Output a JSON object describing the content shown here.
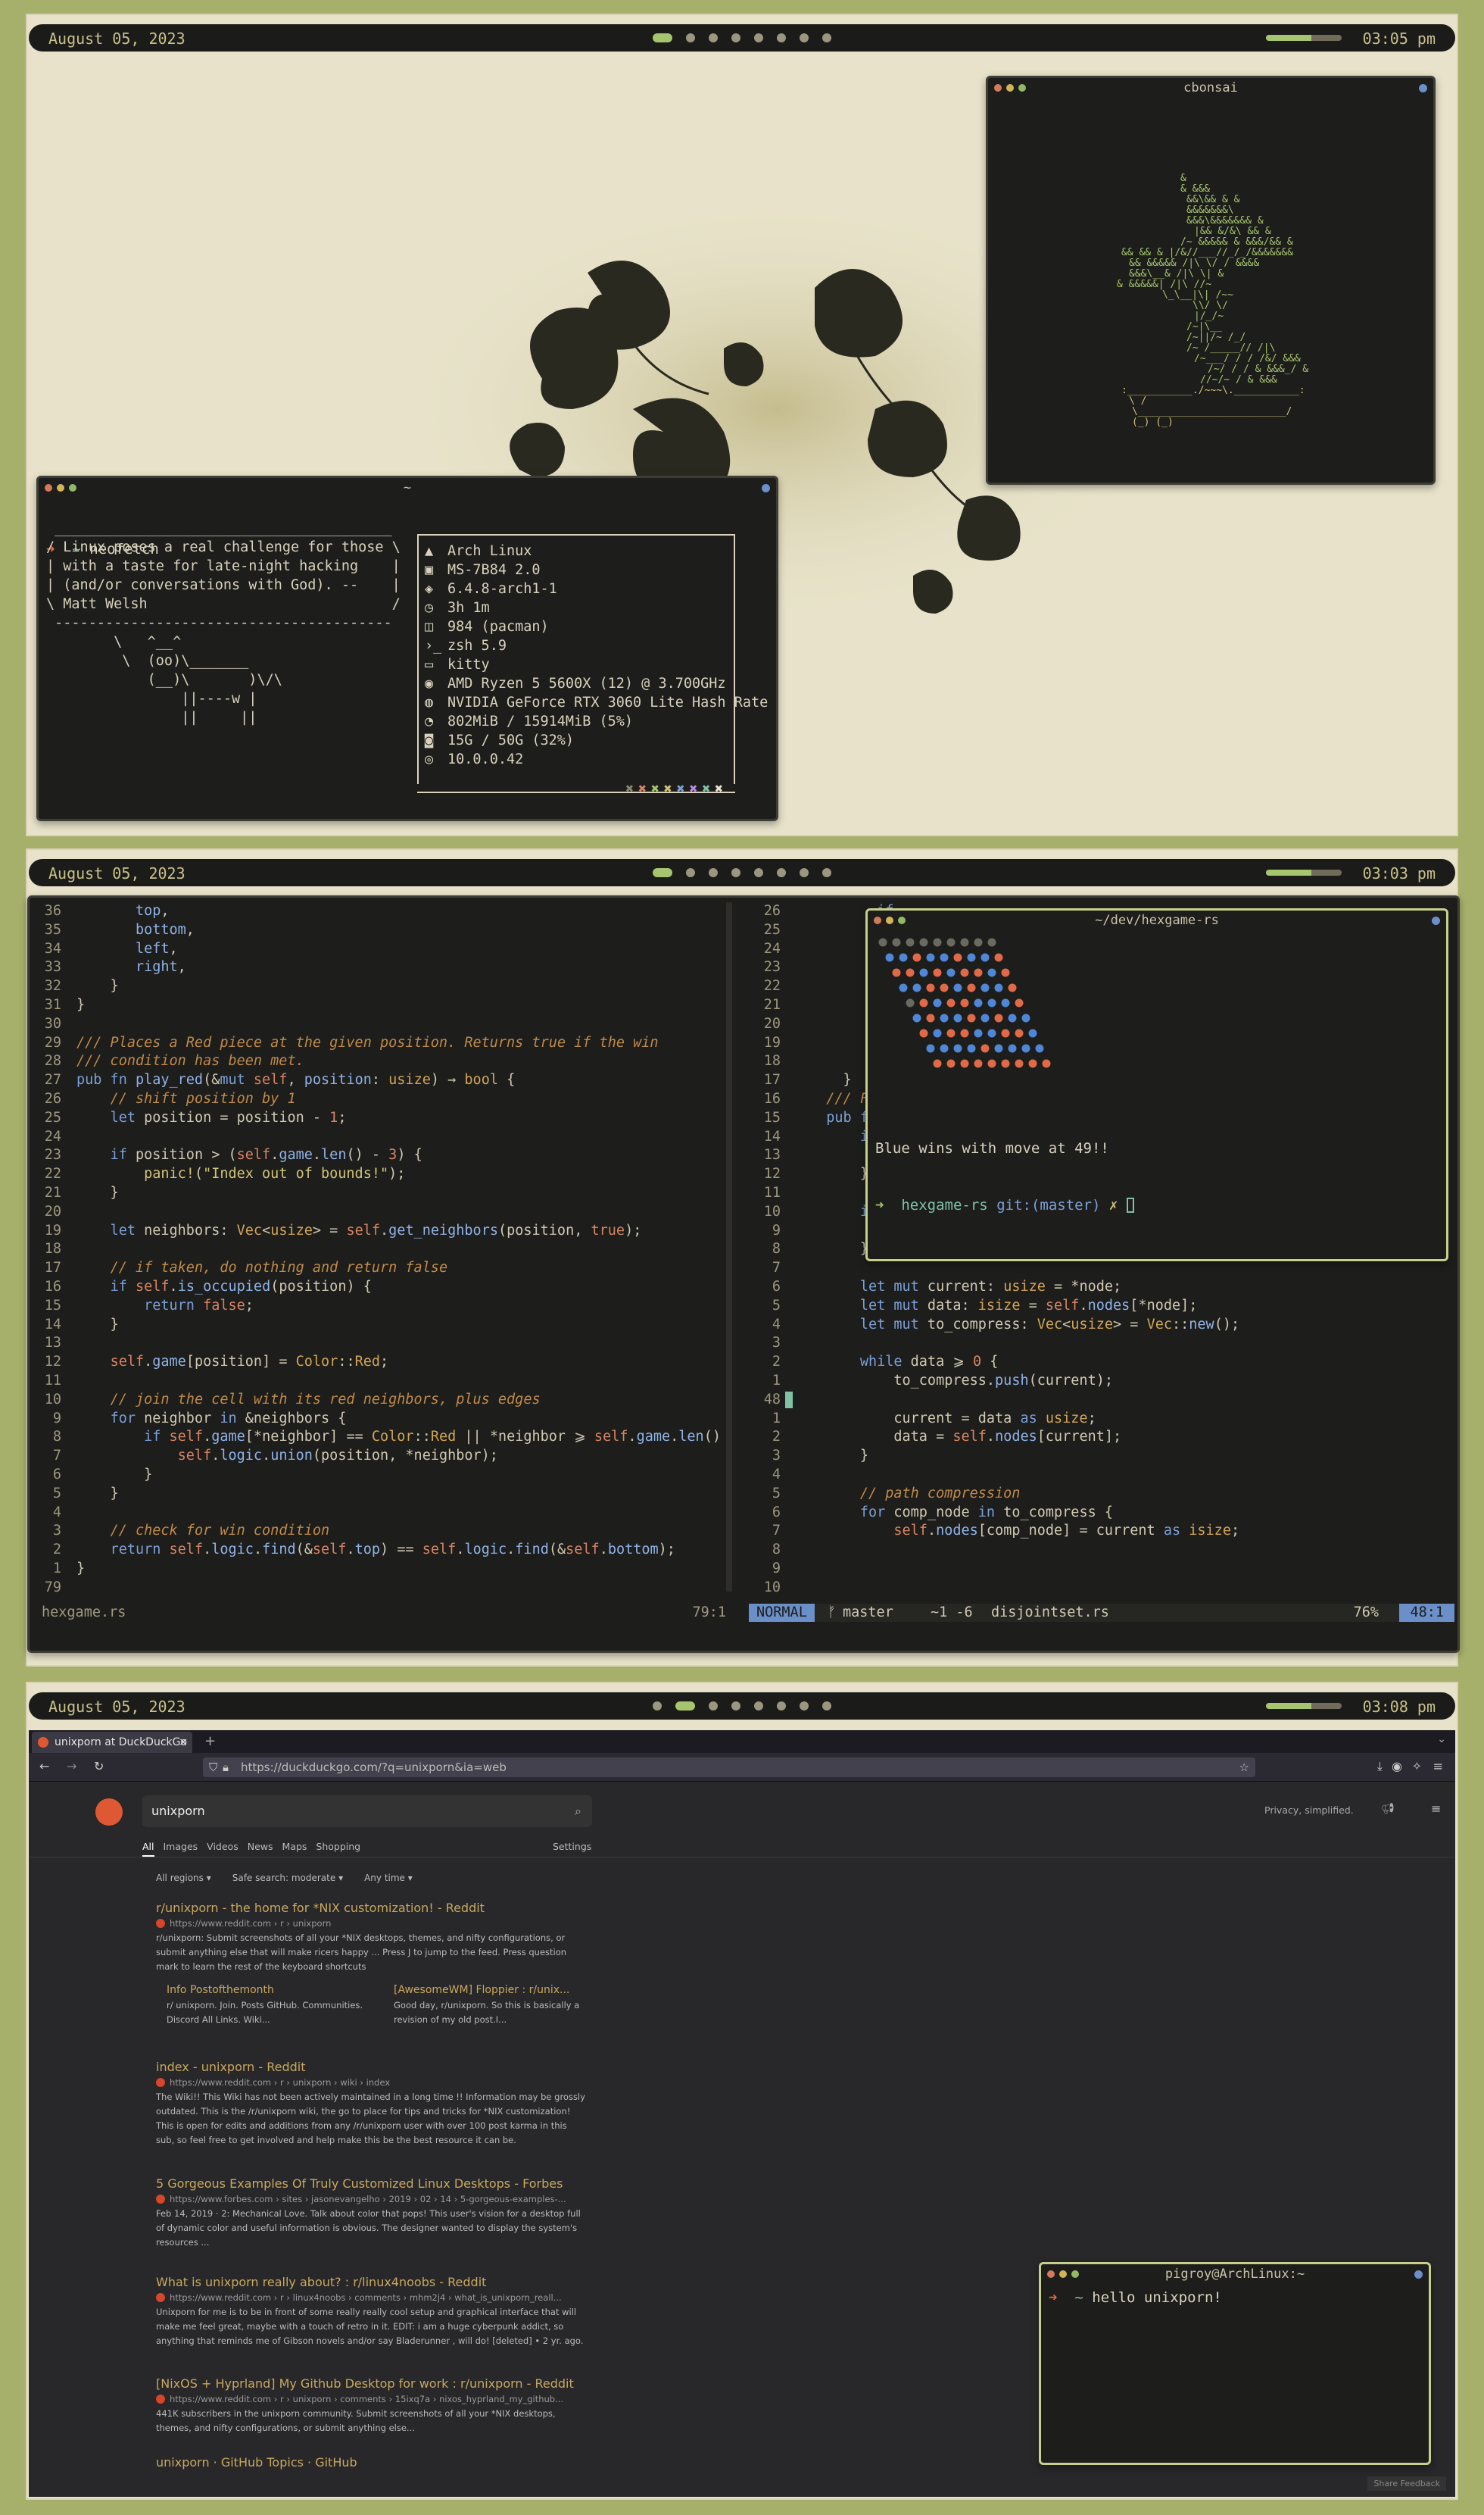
{
  "workspaces": [
    {
      "date": "August 05, 2023",
      "time": "03:05 pm",
      "active_index": 0,
      "dot_count": 8
    },
    {
      "date": "August 05, 2023",
      "time": "03:03 pm",
      "active_index": 0,
      "dot_count": 8
    },
    {
      "date": "August 05, 2023",
      "time": "03:08 pm",
      "active_index": 1,
      "dot_count": 8
    }
  ],
  "cbonsai": {
    "title": "cbonsai"
  },
  "neofetch": {
    "title": "~",
    "prompt_cmd": "neofetch",
    "quote_lines": [
      " ________________________________________",
      "/ Linux poses a real challenge for those \\",
      "| with a taste for late-night hacking    |",
      "| (and/or conversations with God). --    |",
      "\\ Matt Welsh                             /",
      " ----------------------------------------",
      "        \\   ^__^",
      "         \\  (oo)\\_______",
      "            (__)\\       )\\/\\",
      "                ||----w |",
      "                ||     ||"
    ],
    "info": [
      {
        "icon": "arch-icon",
        "text": "Arch Linux"
      },
      {
        "icon": "host-icon",
        "text": "MS-7B84 2.0"
      },
      {
        "icon": "kernel-icon",
        "text": "6.4.8-arch1-1"
      },
      {
        "icon": "clock-icon",
        "text": "3h 1m"
      },
      {
        "icon": "package-icon",
        "text": "984 (pacman)"
      },
      {
        "icon": "shell-icon",
        "text": "zsh 5.9"
      },
      {
        "icon": "terminal-icon",
        "text": "kitty"
      },
      {
        "icon": "cpu-icon",
        "text": "AMD Ryzen 5 5600X (12) @ 3.700GHz"
      },
      {
        "icon": "gpu-icon",
        "text": "NVIDIA GeForce RTX 3060 Lite Hash Rate"
      },
      {
        "icon": "memory-icon",
        "text": "802MiB / 15914MiB (5%)"
      },
      {
        "icon": "disk-icon",
        "text": "15G / 50G (32%)"
      },
      {
        "icon": "network-icon",
        "text": "10.0.0.42"
      }
    ],
    "palette": [
      "#8a8672",
      "#d88463",
      "#a7c46e",
      "#d2c27a",
      "#7b9fd8",
      "#b58ad8",
      "#7fc2a6",
      "#e8e2cc"
    ]
  },
  "editor": {
    "left_file": "hexgame.rs",
    "left_pos": "79:1",
    "mode": "NORMAL",
    "branch": "master",
    "diff": "~1 -6",
    "right_file": "disjointset.rs",
    "percent": "76%",
    "right_pos": "48:1",
    "left_gutter": [
      "36",
      "35",
      "34",
      "33",
      "32",
      "31",
      "30",
      "29",
      "28",
      "27",
      "26",
      "25",
      "24",
      "23",
      "22",
      "21",
      "20",
      "19",
      "18",
      "17",
      "16",
      "15",
      "14",
      "13",
      "12",
      "11",
      "10",
      "9",
      "8",
      "7",
      "6",
      "5",
      "4",
      "3",
      "2",
      "1",
      "79"
    ],
    "right_gutter": [
      "26",
      "25",
      "24",
      "23",
      "22",
      "21",
      "20",
      "19",
      "18",
      "17",
      "16",
      "15",
      "14",
      "13",
      "12",
      "11",
      "10",
      "9",
      "8",
      "7",
      "6",
      "5",
      "4",
      "3",
      "2",
      "1",
      "48",
      "1",
      "2",
      "3",
      "4",
      "5",
      "6",
      "7",
      "8",
      "9",
      "10"
    ]
  },
  "hexgame": {
    "title": "~/dev/hexgame-rs",
    "message": "Blue wins with move at 49!!",
    "dir": "hexgame-rs",
    "git": "git:(master)",
    "mark": "✗"
  },
  "browser": {
    "tab_title": "unixporn at DuckDuckGo",
    "url": "https://duckduckgo.com/?q=unixporn&ia=web",
    "query": "unixporn",
    "privacy": "Privacy, simplified.",
    "tabs": [
      "All",
      "Images",
      "Videos",
      "News",
      "Maps",
      "Shopping"
    ],
    "settings": "Settings",
    "filters": [
      "All regions",
      "Safe search: moderate",
      "Any time"
    ],
    "results": [
      {
        "title": "r/unixporn - the home for *NIX customization! - Reddit",
        "url": "https://www.reddit.com › r › unixporn",
        "snippet": "r/unixporn: Submit screenshots of all your *NIX desktops, themes, and nifty configurations, or submit anything else that will make ricers happy ... Press J to jump to the feed. Press question mark to learn the rest of the keyboard shortcuts"
      },
      {
        "title": "index - unixporn - Reddit",
        "url": "https://www.reddit.com › r › unixporn › wiki › index",
        "snippet": "The Wiki!! This Wiki has not been actively maintained in a long time !! Information may be grossly outdated. This is the /r/unixporn wiki, the go to place for tips and tricks for *NIX customization! This is open for edits and additions from any /r/unixporn user with over 100 post karma in this sub, so feel free to get involved and help make this be the best resource it can be."
      },
      {
        "title": "5 Gorgeous Examples Of Truly Customized Linux Desktops - Forbes",
        "url": "https://www.forbes.com › sites › jasonevangelho › 2019 › 02 › 14 › 5-gorgeous-examples-...",
        "snippet": "Feb 14, 2019 · 2: Mechanical Love. Talk about color that pops! This user's vision for a desktop full of dynamic color and useful information is obvious. The designer wanted to display the system's resources ..."
      },
      {
        "title": "What is unixporn really about? : r/linux4noobs - Reddit",
        "url": "https://www.reddit.com › r › linux4noobs › comments › mhm2j4 › what_is_unixporn_reall...",
        "snippet": "Unixporn for me is to be in front of some really really cool setup and graphical interface that will make me feel great, maybe with a touch of retro in it. EDIT: i am a huge cyberpunk addict, so anything that reminds me of Gibson novels and/or say Bladerunner , will do! [deleted] • 2 yr. ago."
      },
      {
        "title": "[NixOS + Hyprland] My Github Desktop for work : r/unixporn - Reddit",
        "url": "https://www.reddit.com › r › unixporn › comments › 15ixq7a › nixos_hyprland_my_github...",
        "snippet": "441K subscribers in the unixporn community. Submit screenshots of all your *NIX desktops, themes, and nifty configurations, or submit anything else..."
      },
      {
        "title": "unixporn · GitHub Topics · GitHub",
        "url": "",
        "snippet": ""
      }
    ],
    "sitelinks": [
      {
        "title": "Info Postofthemonth",
        "snippet": "r/ unixporn. Join. Posts GitHub. Communities. Discord All Links. Wiki..."
      },
      {
        "title": "[AwesomeWM] Floppier : r/unix...",
        "snippet": "Good day, r/unixporn. So this is basically a revision of my old post.I..."
      }
    ],
    "feedback": "Share Feedback"
  },
  "small_term": {
    "title": "pigroy@ArchLinux:~",
    "cmd": "hello unixporn!"
  }
}
